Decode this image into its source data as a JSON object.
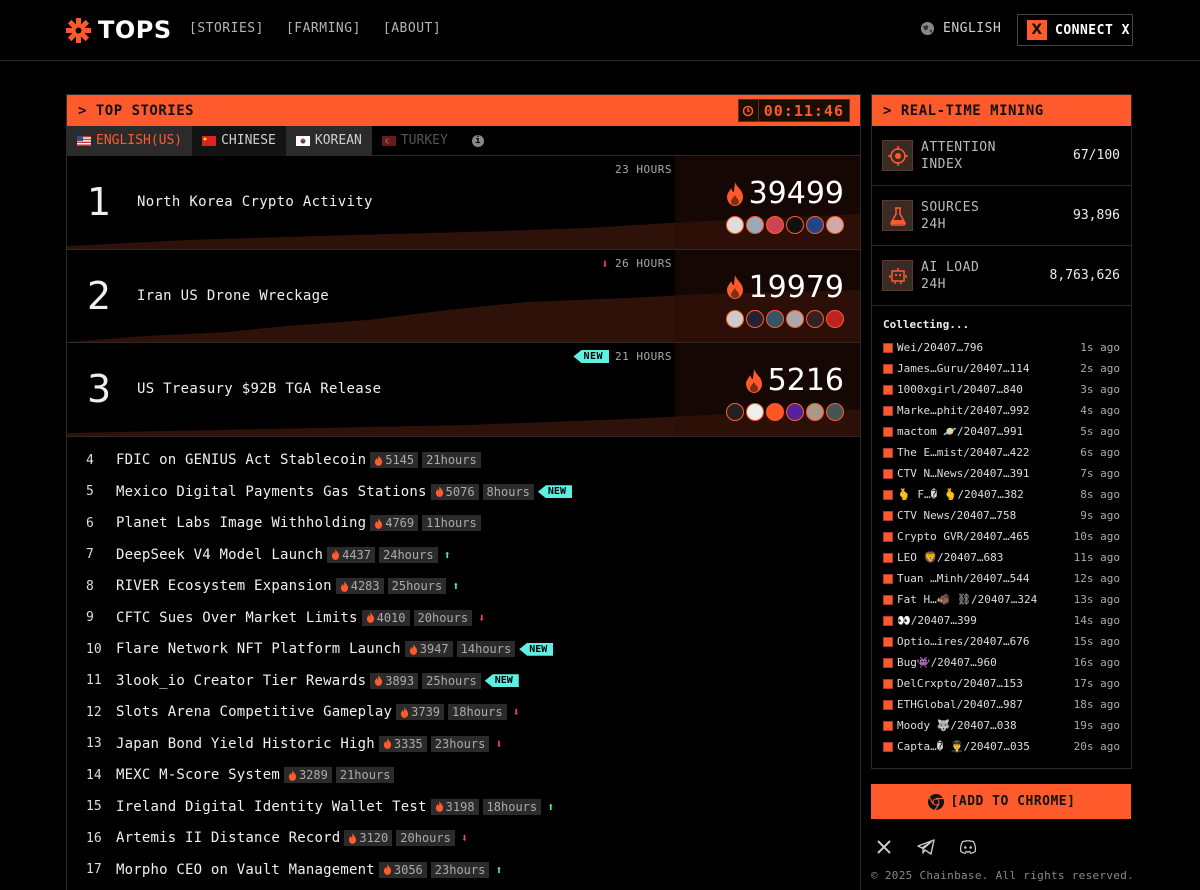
{
  "header": {
    "brand": "TOPS",
    "nav": [
      "[STORIES]",
      "[FARMING]",
      "[ABOUT]"
    ],
    "language": "ENGLISH",
    "connect_label": "CONNECT X",
    "x_badge": "X"
  },
  "stories": {
    "title": "> TOP STORIES",
    "timer": "00:11:46",
    "tabs": [
      {
        "label": "ENGLISH(US)"
      },
      {
        "label": "CHINESE"
      },
      {
        "label": "KOREAN"
      },
      {
        "label": "TURKEY"
      }
    ],
    "info_glyph": "i",
    "top": [
      {
        "rank": "1",
        "title": "North Korea Crypto Activity",
        "hours": "23 HOURS",
        "score": "39499",
        "trend": "",
        "new": ""
      },
      {
        "rank": "2",
        "title": "Iran US Drone Wreckage",
        "hours": "26 HOURS",
        "score": "19979",
        "trend": "down",
        "new": ""
      },
      {
        "rank": "3",
        "title": "US Treasury $92B TGA Release",
        "hours": "21 HOURS",
        "score": "5216",
        "trend": "",
        "new": "NEW"
      }
    ],
    "list": [
      {
        "rank": "4",
        "title": "FDIC on GENIUS Act Stablecoin",
        "score": "5145",
        "hours": "21hours",
        "trend": "",
        "new": ""
      },
      {
        "rank": "5",
        "title": "Mexico Digital Payments Gas Stations",
        "score": "5076",
        "hours": "8hours",
        "trend": "",
        "new": "NEW"
      },
      {
        "rank": "6",
        "title": "Planet Labs Image Withholding",
        "score": "4769",
        "hours": "11hours",
        "trend": "",
        "new": ""
      },
      {
        "rank": "7",
        "title": "DeepSeek V4 Model Launch",
        "score": "4437",
        "hours": "24hours",
        "trend": "up",
        "new": ""
      },
      {
        "rank": "8",
        "title": "RIVER Ecosystem Expansion",
        "score": "4283",
        "hours": "25hours",
        "trend": "up",
        "new": ""
      },
      {
        "rank": "9",
        "title": "CFTC Sues Over Market Limits",
        "score": "4010",
        "hours": "20hours",
        "trend": "down",
        "new": ""
      },
      {
        "rank": "10",
        "title": "Flare Network NFT Platform Launch",
        "score": "3947",
        "hours": "14hours",
        "trend": "",
        "new": "NEW"
      },
      {
        "rank": "11",
        "title": "3look_io Creator Tier Rewards",
        "score": "3893",
        "hours": "25hours",
        "trend": "",
        "new": "NEW"
      },
      {
        "rank": "12",
        "title": "Slots Arena Competitive Gameplay",
        "score": "3739",
        "hours": "18hours",
        "trend": "down",
        "new": ""
      },
      {
        "rank": "13",
        "title": "Japan Bond Yield Historic High",
        "score": "3335",
        "hours": "23hours",
        "trend": "down",
        "new": ""
      },
      {
        "rank": "14",
        "title": "MEXC M-Score System",
        "score": "3289",
        "hours": "21hours",
        "trend": "",
        "new": ""
      },
      {
        "rank": "15",
        "title": "Ireland Digital Identity Wallet Test",
        "score": "3198",
        "hours": "18hours",
        "trend": "up",
        "new": ""
      },
      {
        "rank": "16",
        "title": "Artemis II Distance Record",
        "score": "3120",
        "hours": "20hours",
        "trend": "down",
        "new": ""
      },
      {
        "rank": "17",
        "title": "Morpho CEO on Vault Management",
        "score": "3056",
        "hours": "23hours",
        "trend": "up",
        "new": ""
      }
    ]
  },
  "mining": {
    "title": "> REAL-TIME MINING",
    "metrics": [
      {
        "label1": "ATTENTION",
        "label2": "INDEX",
        "value": "67/100",
        "icon": "target-icon"
      },
      {
        "label1": "SOURCES",
        "label2": "24H",
        "value": "93,896",
        "icon": "flask-icon"
      },
      {
        "label1": "AI LOAD",
        "label2": "24H",
        "value": "8,763,626",
        "icon": "robot-icon"
      }
    ],
    "collecting": "Collecting...",
    "feed": [
      {
        "name": "Wei/20407…796",
        "time": "1s ago"
      },
      {
        "name": "James…Guru/20407…114",
        "time": "2s ago"
      },
      {
        "name": "1000xgirl/20407…840",
        "time": "3s ago"
      },
      {
        "name": "Marke…phit/20407…992",
        "time": "4s ago"
      },
      {
        "name": "mactom 🪐/20407…991",
        "time": "5s ago"
      },
      {
        "name": "The E…mist/20407…422",
        "time": "6s ago"
      },
      {
        "name": "CTV N…News/20407…391",
        "time": "7s ago"
      },
      {
        "name": "🫰 F…� 🫰/20407…382",
        "time": "8s ago"
      },
      {
        "name": "CTV News/20407…758",
        "time": "9s ago"
      },
      {
        "name": "Crypto GVR/20407…465",
        "time": "10s ago"
      },
      {
        "name": "LEO 🦁/20407…683",
        "time": "11s ago"
      },
      {
        "name": "Tuan …Minh/20407…544",
        "time": "12s ago"
      },
      {
        "name": "Fat H…🐗 ⛓/20407…324",
        "time": "13s ago"
      },
      {
        "name": "👀/20407…399",
        "time": "14s ago"
      },
      {
        "name": "Optio…ires/20407…676",
        "time": "15s ago"
      },
      {
        "name": "Bug👾/20407…960",
        "time": "16s ago"
      },
      {
        "name": "DelCrxpto/20407…153",
        "time": "17s ago"
      },
      {
        "name": "ETHGlobal/20407…987",
        "time": "18s ago"
      },
      {
        "name": "Moody 🐺/20407…038",
        "time": "19s ago"
      },
      {
        "name": "Capta…� 👨‍✈️/20407…035",
        "time": "20s ago"
      }
    ],
    "chrome_label": "[ADD TO CHROME]"
  },
  "footer": {
    "copyright": "© 2025 Chainbase. All rights reserved."
  },
  "colors": {
    "accent": "#ff5a2c",
    "new_badge": "#5ff0e4",
    "up": "#4cf08a",
    "down": "#ff3b6b"
  }
}
